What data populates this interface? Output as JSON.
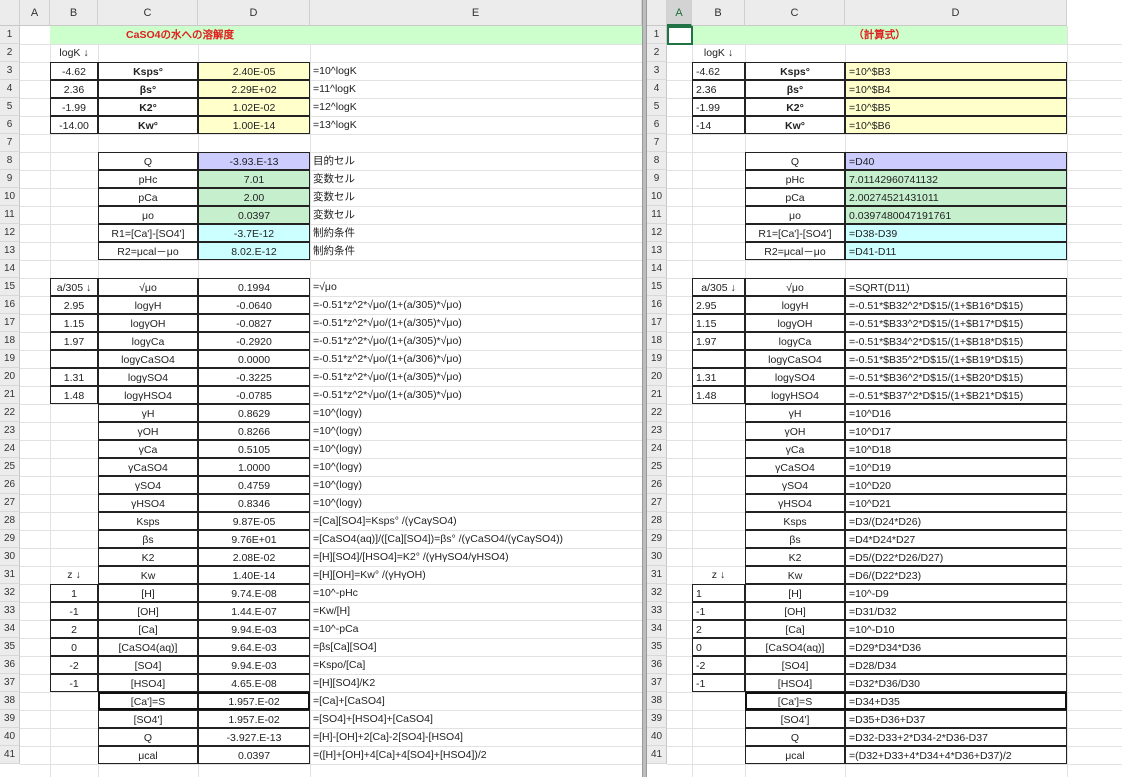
{
  "left": {
    "columns": [
      "A",
      "B",
      "C",
      "D",
      "E"
    ],
    "title": "CaSO4の水への溶解度",
    "b2": "logK ↓",
    "consts": [
      {
        "b": "-4.62",
        "c": "Ksps°",
        "d": "2.40E-05",
        "e": "=10^logK"
      },
      {
        "b": "2.36",
        "c": "βs°",
        "d": "2.29E+02",
        "e": "=11^logK"
      },
      {
        "b": "-1.99",
        "c": "K2°",
        "d": "1.02E-02",
        "e": "=12^logK"
      },
      {
        "b": "-14.00",
        "c": "Kw°",
        "d": "1.00E-14",
        "e": "=13^logK"
      }
    ],
    "vars": [
      {
        "c": "Q",
        "d": "-3.93.E-13",
        "e": "目的セル"
      },
      {
        "c": "pHc",
        "d": "7.01",
        "e": "変数セル"
      },
      {
        "c": "pCa",
        "d": "2.00",
        "e": "変数セル"
      },
      {
        "c": "μo",
        "d": "0.0397",
        "e": "変数セル"
      },
      {
        "c": "R1=[Ca']-[SO4']",
        "d": "-3.7E-12",
        "e": "制約条件"
      },
      {
        "c": "R2=μcal－μo",
        "d": "8.02.E-12",
        "e": "制約条件"
      }
    ],
    "b15": "a/305 ↓",
    "b31": "z ↓",
    "rows": [
      {
        "r": 15,
        "b": "",
        "c": "√μo",
        "d": "0.1994",
        "e": "=√μo"
      },
      {
        "r": 16,
        "b": "2.95",
        "c": "logγH",
        "d": "-0.0640",
        "e": "=-0.51*z^2*√μo/(1+(a/305)*√μo)"
      },
      {
        "r": 17,
        "b": "1.15",
        "c": "logγOH",
        "d": "-0.0827",
        "e": "=-0.51*z^2*√μo/(1+(a/305)*√μo)"
      },
      {
        "r": 18,
        "b": "1.97",
        "c": "logγCa",
        "d": "-0.2920",
        "e": "=-0.51*z^2*√μo/(1+(a/305)*√μo)"
      },
      {
        "r": 19,
        "b": "",
        "c": "logγCaSO4",
        "d": "0.0000",
        "e": "=-0.51*z^2*√μo/(1+(a/306)*√μo)"
      },
      {
        "r": 20,
        "b": "1.31",
        "c": "logγSO4",
        "d": "-0.3225",
        "e": "=-0.51*z^2*√μo/(1+(a/305)*√μo)"
      },
      {
        "r": 21,
        "b": "1.48",
        "c": "logγHSO4",
        "d": "-0.0785",
        "e": "=-0.51*z^2*√μo/(1+(a/305)*√μo)"
      },
      {
        "r": 22,
        "b": "",
        "c": "γH",
        "d": "0.8629",
        "e": "=10^(logγ)"
      },
      {
        "r": 23,
        "b": "",
        "c": "γOH",
        "d": "0.8266",
        "e": "=10^(logγ)"
      },
      {
        "r": 24,
        "b": "",
        "c": "γCa",
        "d": "0.5105",
        "e": "=10^(logγ)"
      },
      {
        "r": 25,
        "b": "",
        "c": "γCaSO4",
        "d": "1.0000",
        "e": "=10^(logγ)"
      },
      {
        "r": 26,
        "b": "",
        "c": "γSO4",
        "d": "0.4759",
        "e": "=10^(logγ)"
      },
      {
        "r": 27,
        "b": "",
        "c": "γHSO4",
        "d": "0.8346",
        "e": "=10^(logγ)"
      },
      {
        "r": 28,
        "b": "",
        "c": "Ksps",
        "d": "9.87E-05",
        "e": "=[Ca][SO4]=Ksps° /(γCaγSO4)"
      },
      {
        "r": 29,
        "b": "",
        "c": "βs",
        "d": "9.76E+01",
        "e": "=[CaSO4(aq)]/([Ca][SO4])=βs° /(γCaSO4/(γCaγSO4))"
      },
      {
        "r": 30,
        "b": "",
        "c": "K2",
        "d": "2.08E-02",
        "e": "=[H][SO4]/[HSO4]=K2° /(γHγSO4/γHSO4)"
      },
      {
        "r": 31,
        "b": "",
        "c": "Kw",
        "d": "1.40E-14",
        "e": "=[H][OH]=Kw° /(γHγOH)"
      },
      {
        "r": 32,
        "b": "1",
        "c": "[H]",
        "d": "9.74.E-08",
        "e": "=10^-pHc"
      },
      {
        "r": 33,
        "b": "-1",
        "c": "[OH]",
        "d": "1.44.E-07",
        "e": "=Kw/[H]"
      },
      {
        "r": 34,
        "b": "2",
        "c": "[Ca]",
        "d": "9.94.E-03",
        "e": "=10^-pCa"
      },
      {
        "r": 35,
        "b": "0",
        "c": "[CaSO4(aq)]",
        "d": "9.64.E-03",
        "e": "=βs[Ca][SO4]"
      },
      {
        "r": 36,
        "b": "-2",
        "c": "[SO4]",
        "d": "9.94.E-03",
        "e": "=Kspo/[Ca]"
      },
      {
        "r": 37,
        "b": "-1",
        "c": "[HSO4]",
        "d": "4.65.E-08",
        "e": "=[H][SO4]/K2"
      },
      {
        "r": 38,
        "b": "",
        "c": "[Ca']=S",
        "d": "1.957.E-02",
        "e": "=[Ca]+[CaSO4]"
      },
      {
        "r": 39,
        "b": "",
        "c": "[SO4']",
        "d": "1.957.E-02",
        "e": "=[SO4]+[HSO4]+[CaSO4]"
      },
      {
        "r": 40,
        "b": "",
        "c": "Q",
        "d": "-3.927.E-13",
        "e": "=[H]-[OH]+2[Ca]-2[SO4]-[HSO4]"
      },
      {
        "r": 41,
        "b": "",
        "c": "μcal",
        "d": "0.0397",
        "e": "=([H]+[OH]+4[Ca]+4[SO4]+[HSO4])/2"
      }
    ]
  },
  "right": {
    "columns": [
      "A",
      "B",
      "C",
      "D"
    ],
    "title": "（計算式）",
    "b2": "logK ↓",
    "consts": [
      {
        "b": "-4.62",
        "c": "Ksps°",
        "d": "=10^$B3"
      },
      {
        "b": "2.36",
        "c": "βs°",
        "d": "=10^$B4"
      },
      {
        "b": "-1.99",
        "c": "K2°",
        "d": "=10^$B5"
      },
      {
        "b": "-14",
        "c": "Kw°",
        "d": "=10^$B6"
      }
    ],
    "vars": [
      {
        "c": "Q",
        "d": "=D40"
      },
      {
        "c": "pHc",
        "d": "7.01142960741132"
      },
      {
        "c": "pCa",
        "d": "2.00274521431011"
      },
      {
        "c": "μo",
        "d": "0.0397480047191761"
      },
      {
        "c": "R1=[Ca']-[SO4']",
        "d": "=D38-D39"
      },
      {
        "c": "R2=μcal－μo",
        "d": "=D41-D11"
      }
    ],
    "b15": "a/305 ↓",
    "b31": "z ↓",
    "rows": [
      {
        "r": 15,
        "b": "",
        "c": "√μo",
        "d": "=SQRT(D11)"
      },
      {
        "r": 16,
        "b": "2.95",
        "c": "logγH",
        "d": "=-0.51*$B32^2*D$15/(1+$B16*D$15)"
      },
      {
        "r": 17,
        "b": "1.15",
        "c": "logγOH",
        "d": "=-0.51*$B33^2*D$15/(1+$B17*D$15)"
      },
      {
        "r": 18,
        "b": "1.97",
        "c": "logγCa",
        "d": "=-0.51*$B34^2*D$15/(1+$B18*D$15)"
      },
      {
        "r": 19,
        "b": "",
        "c": "logγCaSO4",
        "d": "=-0.51*$B35^2*D$15/(1+$B19*D$15)"
      },
      {
        "r": 20,
        "b": "1.31",
        "c": "logγSO4",
        "d": "=-0.51*$B36^2*D$15/(1+$B20*D$15)"
      },
      {
        "r": 21,
        "b": "1.48",
        "c": "logγHSO4",
        "d": "=-0.51*$B37^2*D$15/(1+$B21*D$15)"
      },
      {
        "r": 22,
        "b": "",
        "c": "γH",
        "d": "=10^D16"
      },
      {
        "r": 23,
        "b": "",
        "c": "γOH",
        "d": "=10^D17"
      },
      {
        "r": 24,
        "b": "",
        "c": "γCa",
        "d": "=10^D18"
      },
      {
        "r": 25,
        "b": "",
        "c": "γCaSO4",
        "d": "=10^D19"
      },
      {
        "r": 26,
        "b": "",
        "c": "γSO4",
        "d": "=10^D20"
      },
      {
        "r": 27,
        "b": "",
        "c": "γHSO4",
        "d": "=10^D21"
      },
      {
        "r": 28,
        "b": "",
        "c": "Ksps",
        "d": "=D3/(D24*D26)"
      },
      {
        "r": 29,
        "b": "",
        "c": "βs",
        "d": "=D4*D24*D27"
      },
      {
        "r": 30,
        "b": "",
        "c": "K2",
        "d": "=D5/(D22*D26/D27)"
      },
      {
        "r": 31,
        "b": "",
        "c": "Kw",
        "d": "=D6/(D22*D23)"
      },
      {
        "r": 32,
        "b": "1",
        "c": "[H]",
        "d": "=10^-D9"
      },
      {
        "r": 33,
        "b": "-1",
        "c": "[OH]",
        "d": "=D31/D32"
      },
      {
        "r": 34,
        "b": "2",
        "c": "[Ca]",
        "d": "=10^-D10"
      },
      {
        "r": 35,
        "b": "0",
        "c": "[CaSO4(aq)]",
        "d": "=D29*D34*D36"
      },
      {
        "r": 36,
        "b": "-2",
        "c": "[SO4]",
        "d": "=D28/D34"
      },
      {
        "r": 37,
        "b": "-1",
        "c": "[HSO4]",
        "d": "=D32*D36/D30"
      },
      {
        "r": 38,
        "b": "",
        "c": "[Ca']=S",
        "d": "=D34+D35"
      },
      {
        "r": 39,
        "b": "",
        "c": "[SO4']",
        "d": "=D35+D36+D37"
      },
      {
        "r": 40,
        "b": "",
        "c": "Q",
        "d": "=D32-D33+2*D34-2*D36-D37"
      },
      {
        "r": 41,
        "b": "",
        "c": "μcal",
        "d": "=(D32+D33+4*D34+4*D36+D37)/2"
      }
    ]
  }
}
